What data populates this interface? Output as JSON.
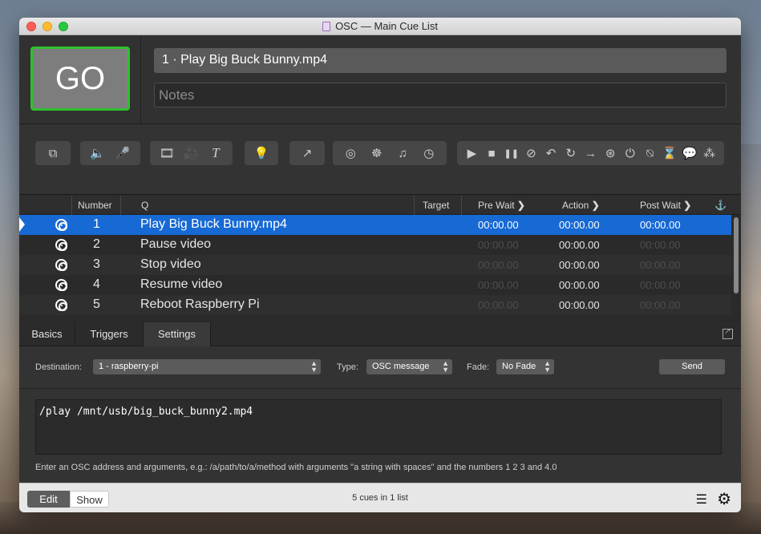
{
  "window": {
    "title": "OSC — Main Cue List"
  },
  "go_button": {
    "label": "GO"
  },
  "cue": {
    "name": "1 · Play Big Buck Bunny.mp4",
    "notes_placeholder": "Notes"
  },
  "toolbar": {
    "icons": [
      "group-icon",
      "audio-icon",
      "mic-icon",
      "video-icon",
      "camera-icon",
      "text-icon",
      "light-icon",
      "fade-icon",
      "network-icon",
      "midi-icon",
      "music-icon",
      "timecode-icon",
      "start-icon",
      "stop-icon",
      "pause-icon",
      "load-icon",
      "reset-icon",
      "devamp-icon",
      "goto-icon",
      "target-icon",
      "arm-icon",
      "disarm-icon",
      "wait-icon",
      "memo-icon",
      "script-icon"
    ],
    "glyphs": {
      "group": "⧉",
      "audio": "🔈",
      "mic": "🎤",
      "video": "🎞",
      "camera": "🎥",
      "text": "T",
      "light": "💡",
      "fade": "↗",
      "network": "◎",
      "midi": "☸",
      "music": "♫",
      "timecode": "◷",
      "start": "▶",
      "stop": "■",
      "pause": "❚❚",
      "load": "⊘",
      "reset": "↶",
      "devamp": "↻",
      "goto": "→",
      "target": "⊛",
      "arm": "⏻",
      "disarm": "⍉",
      "wait": "⌛",
      "memo": "💬",
      "script": "⁂"
    }
  },
  "table": {
    "headers": {
      "number": "Number",
      "q": "Q",
      "target": "Target",
      "pre_wait": "Pre Wait",
      "action": "Action",
      "post_wait": "Post Wait"
    },
    "rows": [
      {
        "number": "1",
        "q": "Play Big Buck Bunny.mp4",
        "pre_wait": "00:00.00",
        "action": "00:00.00",
        "post_wait": "00:00.00"
      },
      {
        "number": "2",
        "q": "Pause video",
        "pre_wait": "00:00.00",
        "action": "00:00.00",
        "post_wait": "00:00.00"
      },
      {
        "number": "3",
        "q": "Stop video",
        "pre_wait": "00:00.00",
        "action": "00:00.00",
        "post_wait": "00:00.00"
      },
      {
        "number": "4",
        "q": "Resume video",
        "pre_wait": "00:00.00",
        "action": "00:00.00",
        "post_wait": "00:00.00"
      },
      {
        "number": "5",
        "q": "Reboot Raspberry Pi",
        "pre_wait": "00:00.00",
        "action": "00:00.00",
        "post_wait": "00:00.00"
      }
    ]
  },
  "inspector": {
    "tabs": [
      "Basics",
      "Triggers",
      "Settings"
    ],
    "active_tab": "Settings",
    "destination_label": "Destination:",
    "destination_value": "1 - raspberry-pi",
    "type_label": "Type:",
    "type_value": "OSC message",
    "fade_label": "Fade:",
    "fade_value": "No Fade",
    "send_label": "Send",
    "osc_message": "/play /mnt/usb/big_buck_bunny2.mp4",
    "hint": "Enter an OSC address and arguments, e.g.: /a/path/to/a/method with arguments \"a string with spaces\" and the numbers 1 2 3 and 4.0"
  },
  "status": {
    "edit_label": "Edit",
    "show_label": "Show",
    "cue_count": "5 cues in 1 list"
  },
  "colors": {
    "go_border": "#2fc02f",
    "selection": "#1769d4"
  }
}
